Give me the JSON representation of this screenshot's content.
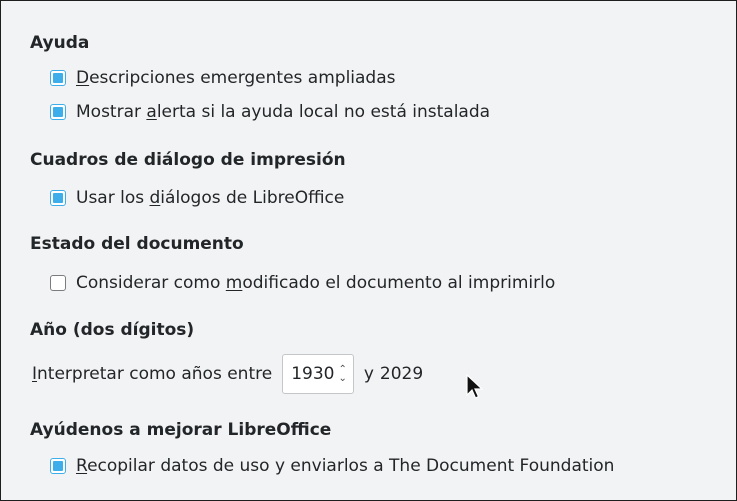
{
  "sections": [
    {
      "heading": "Ayuda",
      "items": [
        {
          "label_pre": "",
          "mnemonic": "D",
          "label_post": "escripciones emergentes ampliadas",
          "checked": true
        },
        {
          "label_pre": "Mostrar ",
          "mnemonic": "a",
          "label_post": "lerta si la ayuda local no está instalada",
          "checked": true
        }
      ]
    },
    {
      "heading": "Cuadros de diálogo de impresión",
      "items": [
        {
          "label_pre": "Usar los ",
          "mnemonic": "d",
          "label_post": "iálogos de LibreOffice",
          "checked": true
        }
      ]
    },
    {
      "heading": "Estado del documento",
      "items": [
        {
          "label_pre": "Considerar como ",
          "mnemonic": "m",
          "label_post": "odificado el documento al imprimirlo",
          "checked": false
        }
      ]
    },
    {
      "heading": "Año (dos dígitos)",
      "year": {
        "label_mnemonic": "I",
        "label_post": "nterpretar como años entre",
        "spin_value": "1930",
        "spin_up": "⌃",
        "spin_down": "⌄",
        "connector": "y",
        "end_year": "2029"
      }
    },
    {
      "heading": "Ayúdenos a mejorar LibreOffice",
      "items": [
        {
          "label_pre": "",
          "mnemonic": "R",
          "label_post": "ecopilar datos de uso y enviarlos a The Document Foundation",
          "checked": true
        }
      ]
    }
  ],
  "colors": {
    "accent": "#3daee9",
    "background": "#f2f3f4",
    "text": "#232629"
  },
  "icons": {
    "cursor": "mouse-pointer-icon"
  }
}
